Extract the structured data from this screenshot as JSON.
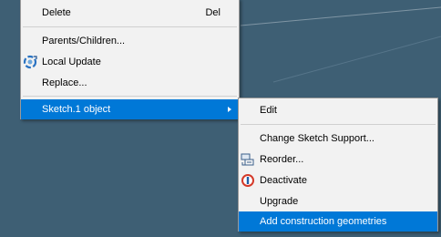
{
  "main_menu": {
    "delete_label": "Delete",
    "delete_shortcut": "Del",
    "parents_children_label": "Parents/Children...",
    "local_update_label": "Local Update",
    "replace_label": "Replace...",
    "sketch_object_label": "Sketch.1 object"
  },
  "sub_menu": {
    "edit_label": "Edit",
    "change_sketch_support_label": "Change Sketch Support...",
    "reorder_label": "Reorder...",
    "deactivate_label": "Deactivate",
    "upgrade_label": "Upgrade",
    "add_construction_geometries_label": "Add construction geometries"
  },
  "icons": {
    "local_update": "local-update-icon",
    "reorder": "reorder-icon",
    "deactivate": "deactivate-icon",
    "submenu_arrow": "chevron-right-icon"
  },
  "colors": {
    "background": "#3e5f74",
    "menu_bg": "#f2f2f2",
    "highlight": "#0078d7"
  }
}
